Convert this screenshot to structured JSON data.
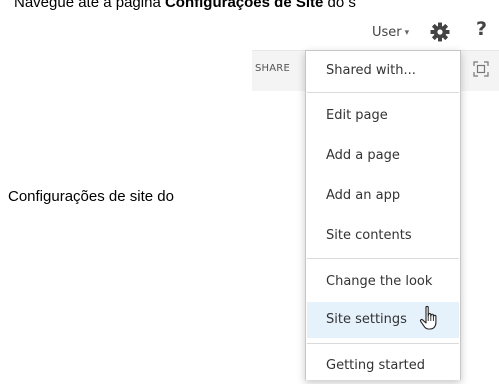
{
  "document": {
    "top_line_prefix": "Navegue até a página",
    "top_line_bold": "Configurações de Site",
    "top_line_suffix": "do s",
    "side_text": "Configurações de site do"
  },
  "topbar": {
    "user_label": "User",
    "user_caret": "▾",
    "gear_icon": "gear-icon",
    "help_label": "?"
  },
  "ribbon": {
    "share_label": "SHARE",
    "focus_icon": "focus-on-content-icon"
  },
  "menu": {
    "items": [
      {
        "label": "Shared with..."
      },
      {
        "label": "Edit page"
      },
      {
        "label": "Add a page"
      },
      {
        "label": "Add an app"
      },
      {
        "label": "Site contents"
      },
      {
        "label": "Change the look"
      },
      {
        "label": "Site settings",
        "hovered": true
      },
      {
        "label": "Getting started"
      }
    ],
    "hover_color": "#e5f1fb",
    "border_color": "#c6c6c6"
  }
}
